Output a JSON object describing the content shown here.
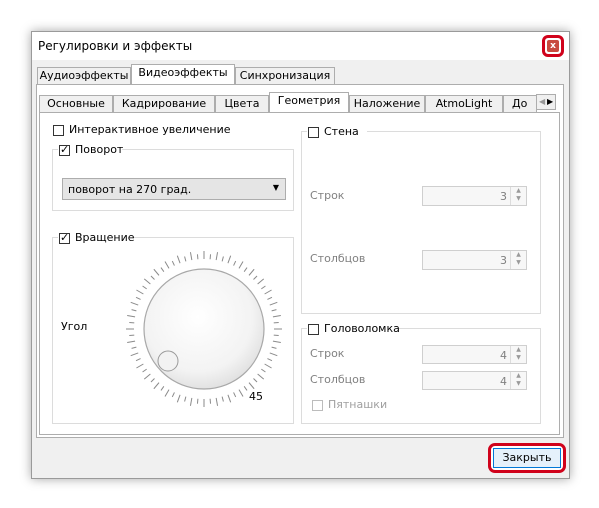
{
  "window": {
    "title": "Регулировки и эффекты",
    "close_glyph": "x"
  },
  "main_tabs": [
    "Аудиоэффекты",
    "Видеоэффекты",
    "Синхронизация"
  ],
  "sub_tabs": [
    "Основные",
    "Кадрирование",
    "Цвета",
    "Геометрия",
    "Наложение",
    "AtmoLight",
    "До"
  ],
  "geometry": {
    "interactive_zoom": {
      "label": "Интерактивное увеличение",
      "checked": false
    },
    "rotate": {
      "label": "Поворот",
      "checked": true,
      "selected": "поворот на 270 град."
    },
    "rotation": {
      "label": "Вращение",
      "checked": true,
      "angle_label": "Угол",
      "angle_value": "45"
    },
    "wall": {
      "label": "Стена",
      "checked": false,
      "rows_label": "Строк",
      "rows_value": "3",
      "cols_label": "Столбцов",
      "cols_value": "3"
    },
    "puzzle": {
      "label": "Головоломка",
      "checked": false,
      "rows_label": "Строк",
      "rows_value": "4",
      "cols_label": "Столбцов",
      "cols_value": "4",
      "fifteen_label": "Пятнашки"
    }
  },
  "footer": {
    "close_label": "Закрыть"
  },
  "colors": {
    "highlight": "#d0021b",
    "accent": "#0078d7"
  }
}
